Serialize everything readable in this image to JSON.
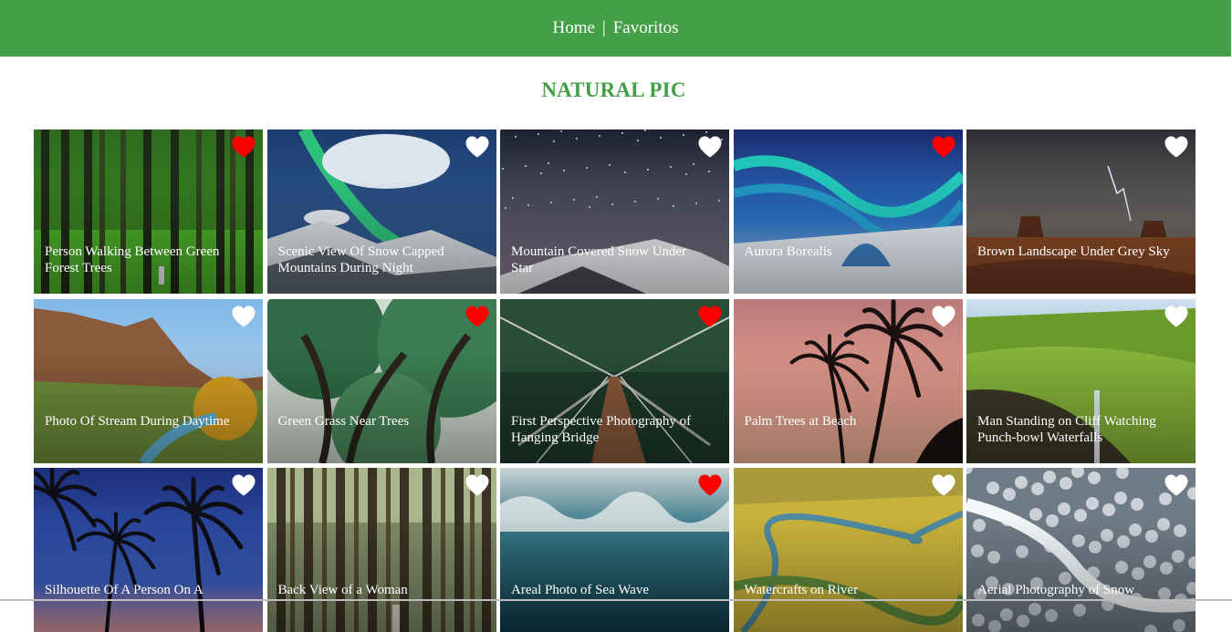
{
  "nav": {
    "home": "Home",
    "separator": "|",
    "favorites": "Favoritos",
    "background": "#43a047"
  },
  "page": {
    "title": "NATURAL PIC",
    "title_color": "#43a047"
  },
  "heart_colors": {
    "favorite": "#ff0000",
    "normal": "#ffffff"
  },
  "photos": [
    {
      "caption": "Person Walking Between Green Forest Trees",
      "favorite": true,
      "scene": "forest-green"
    },
    {
      "caption": "Scenic View Of Snow Capped Mountains During Night",
      "favorite": false,
      "scene": "night-mountain-aurora"
    },
    {
      "caption": "Mountain Covered Snow Under Star",
      "favorite": false,
      "scene": "starry-snow-mountain"
    },
    {
      "caption": "Aurora Borealis",
      "favorite": true,
      "scene": "aurora-igloo"
    },
    {
      "caption": "Brown Landscape Under Grey Sky",
      "favorite": false,
      "scene": "desert-storm"
    },
    {
      "caption": "Photo Of Stream During Daytime",
      "favorite": false,
      "scene": "canyon-stream"
    },
    {
      "caption": "Green Grass Near Trees",
      "favorite": true,
      "scene": "green-trees"
    },
    {
      "caption": "First Perspective Photography of Hanging Bridge",
      "favorite": true,
      "scene": "hanging-bridge"
    },
    {
      "caption": "Palm Trees at Beach",
      "favorite": false,
      "scene": "palm-sunset"
    },
    {
      "caption": "Man Standing on Cliff Watching Punch-bowl Waterfalls",
      "favorite": false,
      "scene": "cliff-waterfall"
    },
    {
      "caption": "Silhouette Of A Person On A",
      "favorite": false,
      "scene": "palm-blue-night"
    },
    {
      "caption": "Back View of a Woman",
      "favorite": false,
      "scene": "tall-forest"
    },
    {
      "caption": "Areal Photo of Sea Wave",
      "favorite": true,
      "scene": "sea-wave"
    },
    {
      "caption": "Watercrafts on River",
      "favorite": false,
      "scene": "winding-river"
    },
    {
      "caption": "Aerial Photography of Snow",
      "favorite": false,
      "scene": "snow-forest"
    }
  ]
}
